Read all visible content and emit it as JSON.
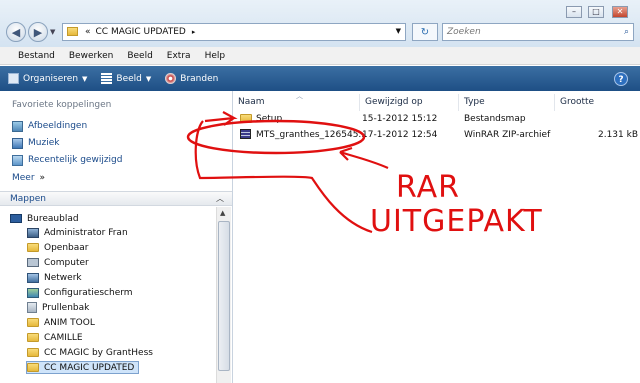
{
  "window": {
    "min_label": "–",
    "max_label": "□",
    "close_label": "✕"
  },
  "address": {
    "path": "CC MAGIC UPDATED",
    "separator_left": "«",
    "separator_right": "▸",
    "refresh_label": "↻",
    "search_placeholder": "Zoeken"
  },
  "menu": [
    "Bestand",
    "Bewerken",
    "Beeld",
    "Extra",
    "Help"
  ],
  "toolbar": {
    "organize": "Organiseren",
    "view": "Beeld",
    "burn": "Branden",
    "help": "?"
  },
  "favorites": {
    "title": "Favoriete koppelingen",
    "items": [
      "Afbeeldingen",
      "Muziek",
      "Recentelijk gewijzigd"
    ],
    "more": "Meer",
    "more_chevron": "»"
  },
  "folders": {
    "title": "Mappen",
    "tree": [
      "Bureaublad",
      "Administrator Fran",
      "Openbaar",
      "Computer",
      "Netwerk",
      "Configuratiescherm",
      "Prullenbak",
      "ANIM TOOL",
      "CAMILLE",
      "CC MAGIC by GrantHess",
      "CC MAGIC UPDATED"
    ]
  },
  "columns": {
    "name": "Naam",
    "modified": "Gewijzigd op",
    "type": "Type",
    "size": "Grootte"
  },
  "files": [
    {
      "name": "Setup",
      "modified": "15-1-2012 15:12",
      "type": "Bestandsmap",
      "size": ""
    },
    {
      "name": "MTS_granthes_126545...",
      "modified": "17-1-2012 12:54",
      "type": "WinRAR ZIP-archief",
      "size": "2.131 kB"
    }
  ],
  "annotation": {
    "line1": "RAR",
    "line2": "UITGEPAKT",
    "color": "#e01010"
  }
}
